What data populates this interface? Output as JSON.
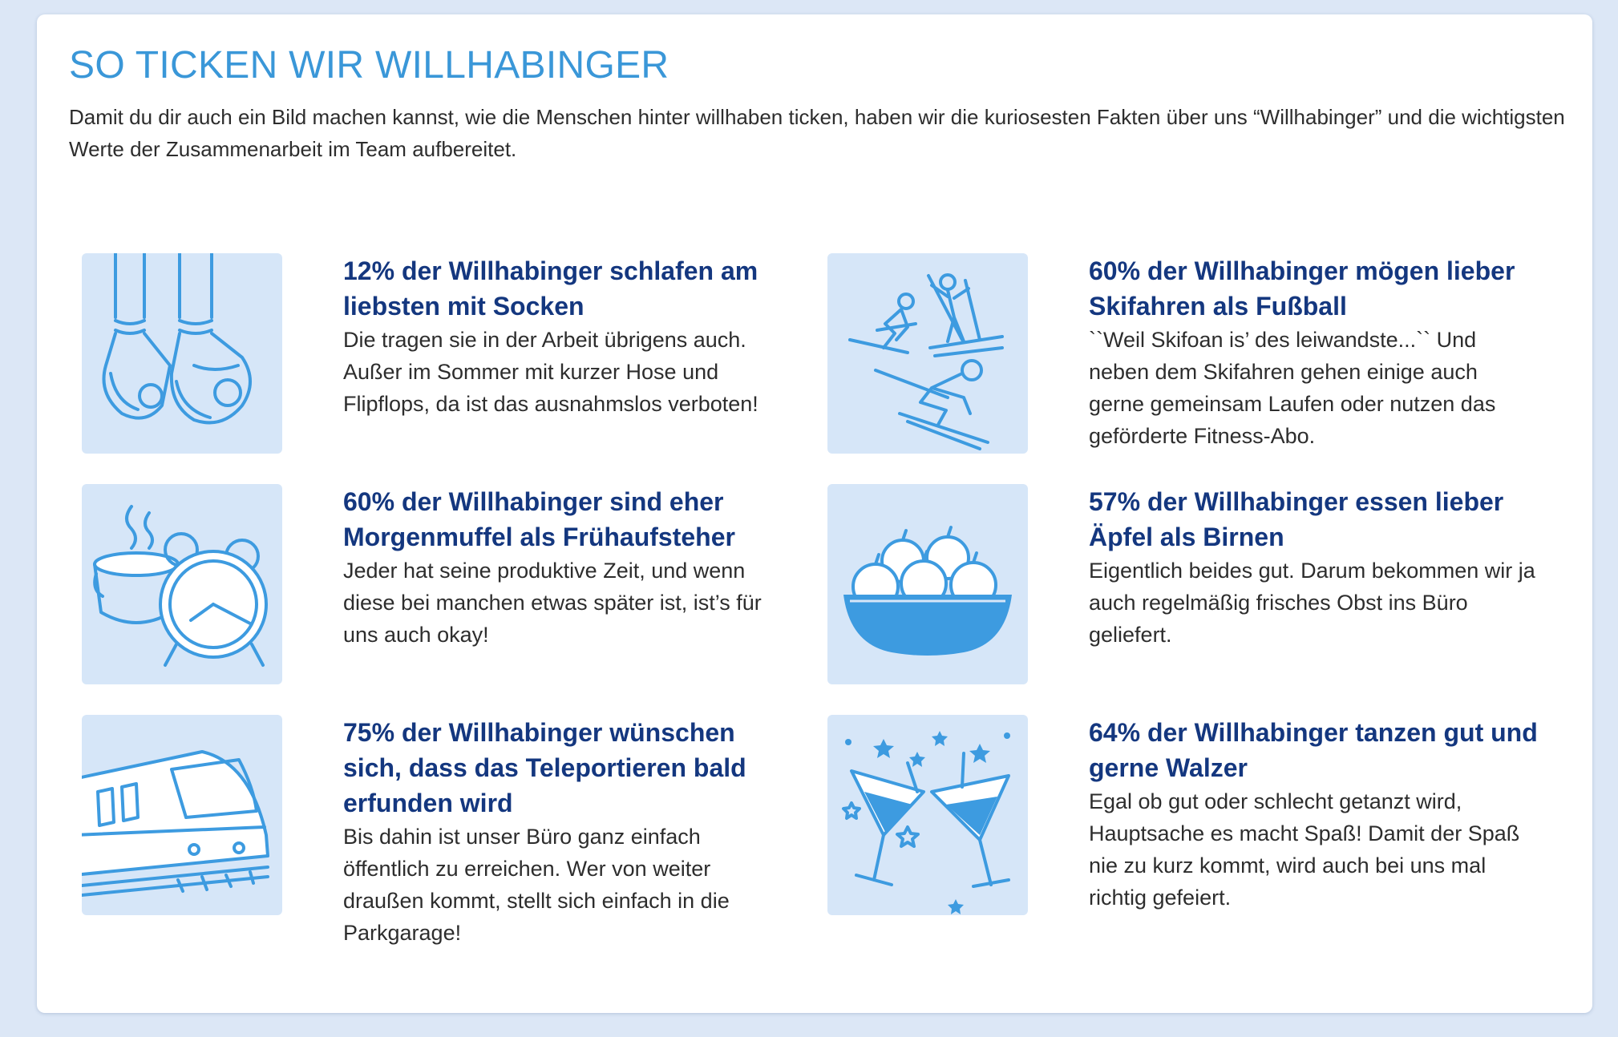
{
  "page": {
    "title": "SO TICKEN WIR WILLHABINGER",
    "intro": "Damit du dir auch ein Bild machen kannst, wie die Menschen hinter willhaben ticken, haben wir die kuriosesten Fakten über uns “Willhabinger” und die wichtigsten Werte der Zusammenarbeit im Team aufbereitet."
  },
  "facts": [
    {
      "icon": "socks-icon",
      "heading": "12% der Willhabinger schlafen am liebsten mit Socken",
      "body": "Die tragen sie in der Arbeit übrigens auch. Außer im Sommer mit kurzer Hose und Flipflops, da ist das ausnahmslos verboten!"
    },
    {
      "icon": "skiers-icon",
      "heading": "60% der Willhabinger mögen lieber Skifahren als Fußball",
      "body": "``Weil Skifoan is’ des leiwandste...`` Und neben dem Skifahren gehen einige auch gerne gemeinsam Laufen oder nutzen das geförderte Fitness-Abo."
    },
    {
      "icon": "coffee-alarm-clock-icon",
      "heading": "60% der Willhabinger sind eher Morgenmuffel als Frühaufsteher",
      "body": "Jeder hat seine produktive Zeit, und wenn diese bei manchen etwas später ist, ist’s für uns auch okay!"
    },
    {
      "icon": "apple-bowl-icon",
      "heading": "57% der Willhabinger essen lieber Äpfel als Birnen",
      "body": "Eigentlich beides gut. Darum bekommen wir ja auch regelmäßig frisches Obst ins Büro geliefert."
    },
    {
      "icon": "train-icon",
      "heading": "75% der Willhabinger wünschen sich, dass das Teleportieren bald erfunden wird",
      "body": "Bis dahin ist unser Büro ganz einfach öffentlich zu erreichen. Wer von weiter draußen kommt, stellt sich einfach in die Parkgarage!"
    },
    {
      "icon": "cocktail-glasses-icon",
      "heading": "64% der Willhabinger tanzen gut und gerne Walzer",
      "body": "Egal ob gut oder schlecht getanzt wird, Hauptsache es macht Spaß! Damit der Spaß nie zu kurz kommt, wird auch bei uns mal richtig gefeiert."
    }
  ],
  "colors": {
    "page_background": "#dce7f6",
    "title": "#3a97d8",
    "heading": "#14377f",
    "body_text": "#2d2d2d",
    "icon_tile": "#d6e6f8",
    "icon_line": "#3d9be0"
  }
}
